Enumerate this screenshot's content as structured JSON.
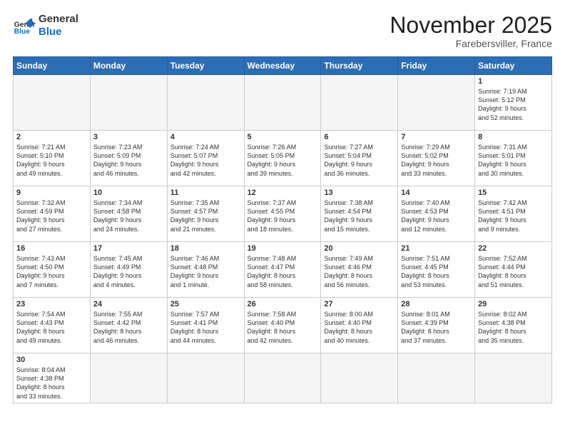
{
  "logo": {
    "text_general": "General",
    "text_blue": "Blue"
  },
  "header": {
    "month": "November 2025",
    "location": "Farebersviller, France"
  },
  "weekdays": [
    "Sunday",
    "Monday",
    "Tuesday",
    "Wednesday",
    "Thursday",
    "Friday",
    "Saturday"
  ],
  "weeks": [
    [
      {
        "day": "",
        "info": ""
      },
      {
        "day": "",
        "info": ""
      },
      {
        "day": "",
        "info": ""
      },
      {
        "day": "",
        "info": ""
      },
      {
        "day": "",
        "info": ""
      },
      {
        "day": "",
        "info": ""
      },
      {
        "day": "1",
        "info": "Sunrise: 7:19 AM\nSunset: 5:12 PM\nDaylight: 9 hours\nand 52 minutes."
      }
    ],
    [
      {
        "day": "2",
        "info": "Sunrise: 7:21 AM\nSunset: 5:10 PM\nDaylight: 9 hours\nand 49 minutes."
      },
      {
        "day": "3",
        "info": "Sunrise: 7:23 AM\nSunset: 5:09 PM\nDaylight: 9 hours\nand 46 minutes."
      },
      {
        "day": "4",
        "info": "Sunrise: 7:24 AM\nSunset: 5:07 PM\nDaylight: 9 hours\nand 42 minutes."
      },
      {
        "day": "5",
        "info": "Sunrise: 7:26 AM\nSunset: 5:05 PM\nDaylight: 9 hours\nand 39 minutes."
      },
      {
        "day": "6",
        "info": "Sunrise: 7:27 AM\nSunset: 5:04 PM\nDaylight: 9 hours\nand 36 minutes."
      },
      {
        "day": "7",
        "info": "Sunrise: 7:29 AM\nSunset: 5:02 PM\nDaylight: 9 hours\nand 33 minutes."
      },
      {
        "day": "8",
        "info": "Sunrise: 7:31 AM\nSunset: 5:01 PM\nDaylight: 9 hours\nand 30 minutes."
      }
    ],
    [
      {
        "day": "9",
        "info": "Sunrise: 7:32 AM\nSunset: 4:59 PM\nDaylight: 9 hours\nand 27 minutes."
      },
      {
        "day": "10",
        "info": "Sunrise: 7:34 AM\nSunset: 4:58 PM\nDaylight: 9 hours\nand 24 minutes."
      },
      {
        "day": "11",
        "info": "Sunrise: 7:35 AM\nSunset: 4:57 PM\nDaylight: 9 hours\nand 21 minutes."
      },
      {
        "day": "12",
        "info": "Sunrise: 7:37 AM\nSunset: 4:55 PM\nDaylight: 9 hours\nand 18 minutes."
      },
      {
        "day": "13",
        "info": "Sunrise: 7:38 AM\nSunset: 4:54 PM\nDaylight: 9 hours\nand 15 minutes."
      },
      {
        "day": "14",
        "info": "Sunrise: 7:40 AM\nSunset: 4:53 PM\nDaylight: 9 hours\nand 12 minutes."
      },
      {
        "day": "15",
        "info": "Sunrise: 7:42 AM\nSunset: 4:51 PM\nDaylight: 9 hours\nand 9 minutes."
      }
    ],
    [
      {
        "day": "16",
        "info": "Sunrise: 7:43 AM\nSunset: 4:50 PM\nDaylight: 9 hours\nand 7 minutes."
      },
      {
        "day": "17",
        "info": "Sunrise: 7:45 AM\nSunset: 4:49 PM\nDaylight: 9 hours\nand 4 minutes."
      },
      {
        "day": "18",
        "info": "Sunrise: 7:46 AM\nSunset: 4:48 PM\nDaylight: 9 hours\nand 1 minute."
      },
      {
        "day": "19",
        "info": "Sunrise: 7:48 AM\nSunset: 4:47 PM\nDaylight: 8 hours\nand 58 minutes."
      },
      {
        "day": "20",
        "info": "Sunrise: 7:49 AM\nSunset: 4:46 PM\nDaylight: 8 hours\nand 56 minutes."
      },
      {
        "day": "21",
        "info": "Sunrise: 7:51 AM\nSunset: 4:45 PM\nDaylight: 8 hours\nand 53 minutes."
      },
      {
        "day": "22",
        "info": "Sunrise: 7:52 AM\nSunset: 4:44 PM\nDaylight: 8 hours\nand 51 minutes."
      }
    ],
    [
      {
        "day": "23",
        "info": "Sunrise: 7:54 AM\nSunset: 4:43 PM\nDaylight: 8 hours\nand 49 minutes."
      },
      {
        "day": "24",
        "info": "Sunrise: 7:55 AM\nSunset: 4:42 PM\nDaylight: 8 hours\nand 46 minutes."
      },
      {
        "day": "25",
        "info": "Sunrise: 7:57 AM\nSunset: 4:41 PM\nDaylight: 8 hours\nand 44 minutes."
      },
      {
        "day": "26",
        "info": "Sunrise: 7:58 AM\nSunset: 4:40 PM\nDaylight: 8 hours\nand 42 minutes."
      },
      {
        "day": "27",
        "info": "Sunrise: 8:00 AM\nSunset: 4:40 PM\nDaylight: 8 hours\nand 40 minutes."
      },
      {
        "day": "28",
        "info": "Sunrise: 8:01 AM\nSunset: 4:39 PM\nDaylight: 8 hours\nand 37 minutes."
      },
      {
        "day": "29",
        "info": "Sunrise: 8:02 AM\nSunset: 4:38 PM\nDaylight: 8 hours\nand 35 minutes."
      }
    ],
    [
      {
        "day": "30",
        "info": "Sunrise: 8:04 AM\nSunset: 4:38 PM\nDaylight: 8 hours\nand 33 minutes."
      },
      {
        "day": "",
        "info": ""
      },
      {
        "day": "",
        "info": ""
      },
      {
        "day": "",
        "info": ""
      },
      {
        "day": "",
        "info": ""
      },
      {
        "day": "",
        "info": ""
      },
      {
        "day": "",
        "info": ""
      }
    ]
  ]
}
